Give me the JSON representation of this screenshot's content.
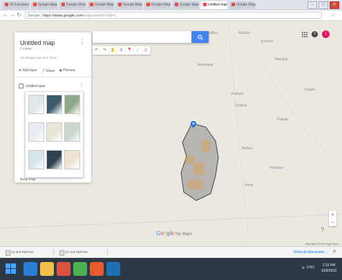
{
  "browser": {
    "tabs": [
      {
        "label": "(4) Facebook"
      },
      {
        "label": "Google Maps"
      },
      {
        "label": "Google Drive"
      },
      {
        "label": "Google Maps"
      },
      {
        "label": "Google Maps"
      },
      {
        "label": "Google Maps"
      },
      {
        "label": "Google Maps"
      },
      {
        "label": "Untitled map"
      },
      {
        "label": "Google Maps"
      }
    ],
    "url_secure": "Secure",
    "url_host": "https://www.google.com",
    "url_path": "/maps/d/edit?mid=1"
  },
  "map_panel": {
    "title": "Untitled map",
    "views": "0 views",
    "updated": "All changes saved in Drive",
    "actions": [
      {
        "icon": "add-layer-icon",
        "label": "Add layer"
      },
      {
        "icon": "share-icon",
        "label": "Share"
      },
      {
        "icon": "preview-icon",
        "label": "Preview"
      }
    ],
    "layer_name": "Untitled layer",
    "basemap_label": "Base map",
    "basemap_colors": [
      "#dfe6ea",
      "#3e5b6b",
      "#8ea98a",
      "#e7ebf2",
      "#e9e4d6",
      "#c9d7cf",
      "#d7e3ea",
      "#2f4250",
      "#efe3d3"
    ]
  },
  "search": {
    "placeholder": ""
  },
  "toolbar": {
    "tools": [
      "↶",
      "↷",
      "✋",
      "⚲",
      "📍",
      "⟋",
      "⊏"
    ]
  },
  "topright": {
    "notif": "0",
    "avatar": "I"
  },
  "places": [
    {
      "name": "Bellary"
    },
    {
      "name": "Raichur"
    },
    {
      "name": "Kurnool"
    },
    {
      "name": "Nandyal"
    },
    {
      "name": "Anantapur"
    },
    {
      "name": "Kadapa"
    },
    {
      "name": "Chittoor"
    },
    {
      "name": "Tirupati"
    },
    {
      "name": "Nellore"
    },
    {
      "name": "Ongole"
    },
    {
      "name": "Hindupur"
    },
    {
      "name": "Kolar"
    }
  ],
  "logo": {
    "google": [
      "G",
      "o",
      "o",
      "g",
      "l",
      "e"
    ],
    "mymaps": "My Maps"
  },
  "attribution": "Map data ©2018 Google  Terms",
  "downloads": {
    "items": [
      "(1) GIS PDF.kml",
      "(1) GIS PDF.kml"
    ],
    "show_all": "Show all downloads..."
  },
  "taskbar": {
    "apps_colors": [
      "#2a7fd4",
      "#f3c04b",
      "#d9533f",
      "#4caf50",
      "#e65a2d",
      "#1f6fb5"
    ],
    "tray": "ENG",
    "time": "2:33 PM",
    "date": "10/8/2018"
  }
}
